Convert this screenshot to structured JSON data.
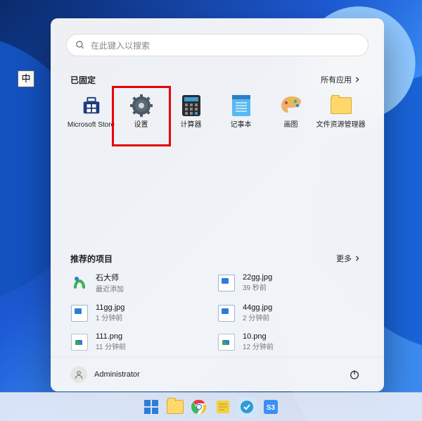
{
  "ime_indicator": "中",
  "search_placeholder": "在此键入以搜索",
  "pinned_header": "已固定",
  "all_apps_label": "所有应用",
  "recommended_header": "推荐的项目",
  "more_label": "更多",
  "pinned": [
    {
      "label": "Microsoft Store",
      "icon": "store"
    },
    {
      "label": "设置",
      "icon": "settings"
    },
    {
      "label": "计算器",
      "icon": "calculator"
    },
    {
      "label": "记事本",
      "icon": "notepad"
    },
    {
      "label": "画图",
      "icon": "paint"
    },
    {
      "label": "文件资源管理器",
      "icon": "explorer"
    }
  ],
  "recommended": [
    {
      "title": "石大师",
      "sub": "最近添加",
      "icon": "sds"
    },
    {
      "title": "22gg.jpg",
      "sub": "39 秒前",
      "icon": "jpg"
    },
    {
      "title": "11gg.jpg",
      "sub": "1 分钟前",
      "icon": "jpg"
    },
    {
      "title": "44gg.jpg",
      "sub": "2 分钟前",
      "icon": "jpg"
    },
    {
      "title": "111.png",
      "sub": "11 分钟前",
      "icon": "png"
    },
    {
      "title": "10.png",
      "sub": "12 分钟前",
      "icon": "png"
    }
  ],
  "user_name": "Administrator",
  "taskbar": [
    "start",
    "explorer",
    "chrome",
    "notes",
    "qq",
    "s3"
  ]
}
